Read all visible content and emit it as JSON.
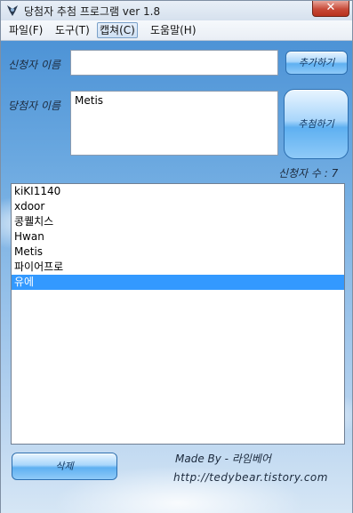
{
  "window": {
    "title": "당첨자 추첨 프로그램 ver 1.8",
    "close_glyph": "✕"
  },
  "menu": {
    "items": [
      {
        "label": "파일(F)"
      },
      {
        "label": "도구(T)"
      },
      {
        "label": "캡쳐(C)",
        "active": true
      },
      {
        "label": "도움말(H)"
      }
    ]
  },
  "form": {
    "applicant_label": "신청자 이름",
    "applicant_value": "",
    "add_button": "추가하기",
    "winner_label": "당첨자 이름",
    "winner_value": "Metis",
    "draw_button": "추첨하기",
    "count_label": "신청자 수 : 7"
  },
  "list": {
    "items": [
      {
        "text": "kiKI1140",
        "selected": false
      },
      {
        "text": "xdoor",
        "selected": false
      },
      {
        "text": "콩퀠치스",
        "selected": false
      },
      {
        "text": "Hwan",
        "selected": false
      },
      {
        "text": "Metis",
        "selected": false
      },
      {
        "text": "파이어프로",
        "selected": false
      },
      {
        "text": "유에",
        "selected": true
      }
    ]
  },
  "footer": {
    "delete_button": "삭제",
    "made_by": "Made By - 라임베어",
    "url": "http://tedybear.tistory.com"
  },
  "colors": {
    "selection": "#3399ff",
    "sky_top": "#4d93d6",
    "sky_bottom": "#d6e6f5"
  }
}
